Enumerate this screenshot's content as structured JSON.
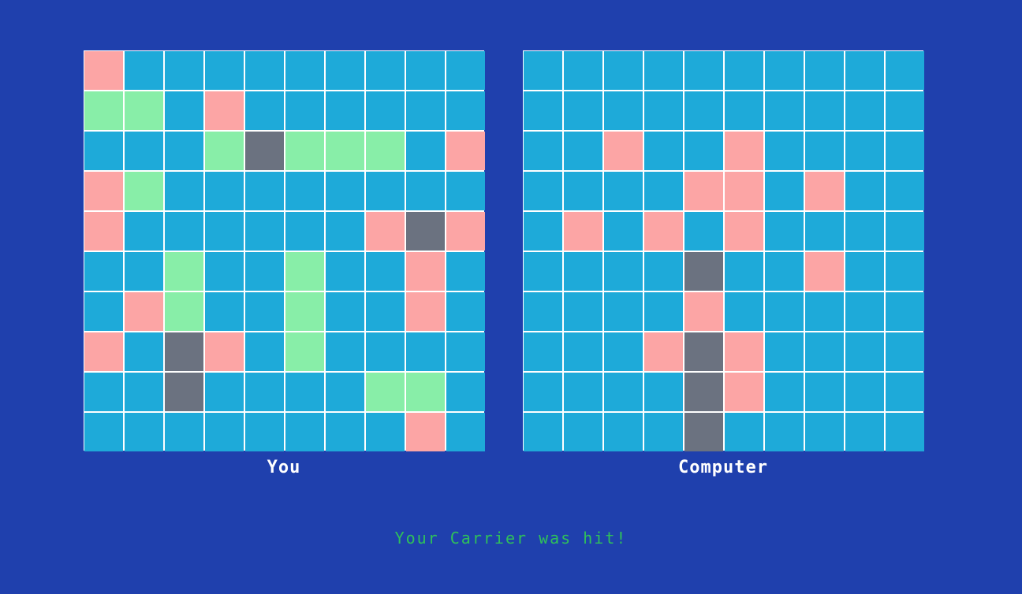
{
  "colors": {
    "background": "#1f40ad",
    "water": "#1eaad9",
    "ship": "#88eea8",
    "hit": "#fca5a5",
    "miss": "#6b7280",
    "grid_lines": "#ffffff",
    "label_text": "#ffffff",
    "status_text": "#2fc05a"
  },
  "legend_codes": {
    "W": "water",
    "S": "ship",
    "H": "hit",
    "M": "miss"
  },
  "player": {
    "label": "You",
    "grid": [
      "HWWWWWWWWW",
      "SSWHWWWWWW",
      "WWWSMSSSWH",
      "HSWWWWWWWW",
      "HWWWWWWHMH",
      "WWSWWSWWHW",
      "WHSWWSWWHW",
      "HWMHWSWWWW",
      "WWMWWWWSSW",
      "WWWWWWWWHW"
    ]
  },
  "computer": {
    "label": "Computer",
    "grid": [
      "WWWWWWWWWW",
      "WWWWWWWWWW",
      "WWHWWHWWWW",
      "WWWWHHWHWW",
      "WHWHWHWWWW",
      "WWWWMWWHWW",
      "WWWWHWWWWW",
      "WWWHMHWWWW",
      "WWWWMHWWWW",
      "WWWWMWWWWW"
    ]
  },
  "status": {
    "message": "Your Carrier was hit!"
  }
}
